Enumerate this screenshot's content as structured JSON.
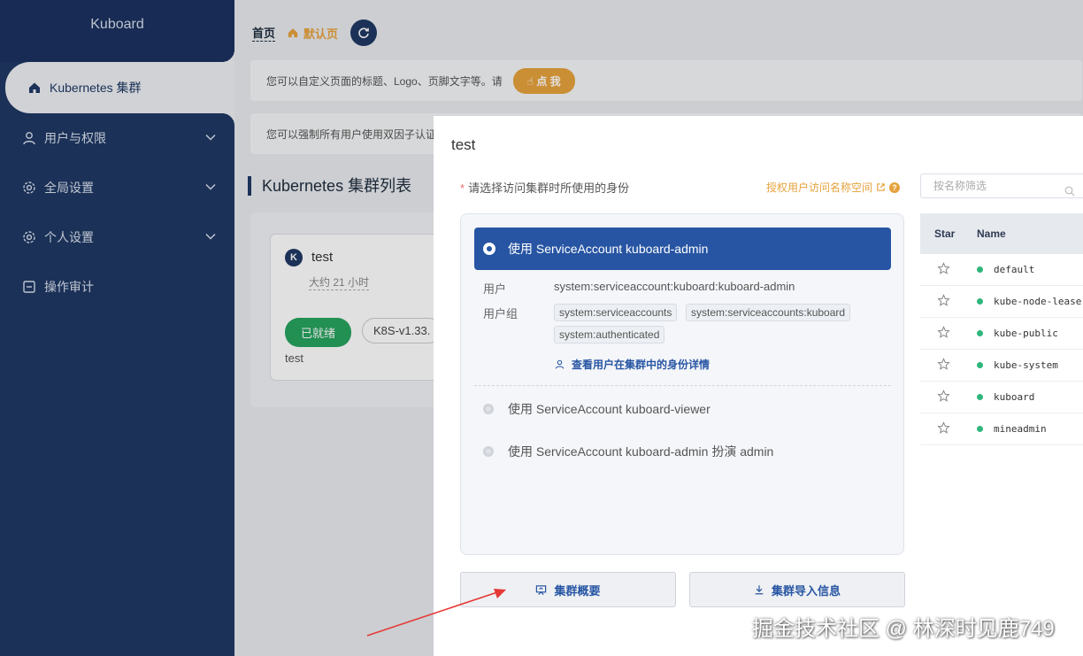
{
  "sidebar": {
    "logo": "Kuboard",
    "items": [
      {
        "label": "Kubernetes 集群",
        "icon": "home-icon"
      },
      {
        "label": "用户与权限",
        "icon": "user-icon"
      },
      {
        "label": "全局设置",
        "icon": "gear-icon"
      },
      {
        "label": "个人设置",
        "icon": "gear-icon"
      },
      {
        "label": "操作审计",
        "icon": "audit-icon"
      }
    ]
  },
  "header": {
    "home": "首页",
    "tab": "默认页"
  },
  "notices": {
    "customize": "您可以自定义页面的标题、Logo、页脚文字等。请",
    "click_me": "点 我",
    "two_factor": "您可以强制所有用户使用双因子认证"
  },
  "section_title": "Kubernetes 集群列表",
  "cluster_card": {
    "name": "test",
    "age": "大约 21 小时",
    "status": "已就绪",
    "version": "K8S-v1.33.",
    "description": "test"
  },
  "modal": {
    "title": "test",
    "identity_label": "请选择访问集群时所使用的身份",
    "grant_link": "授权用户访问名称空间",
    "options": [
      "使用 ServiceAccount kuboard-admin",
      "使用 ServiceAccount kuboard-viewer",
      "使用 ServiceAccount kuboard-admin 扮演 admin"
    ],
    "user_label": "用户",
    "user_value": "system:serviceaccount:kuboard:kuboard-admin",
    "group_label": "用户组",
    "groups": [
      "system:serviceaccounts",
      "system:serviceaccounts:kuboard",
      "system:authenticated"
    ],
    "detail_link": "查看用户在集群中的身份详情",
    "overview_button": "集群概要",
    "import_button": "集群导入信息",
    "filter_placeholder": "按名称筛选",
    "table_headers": {
      "star": "Star",
      "name": "Name"
    },
    "namespaces": [
      "default",
      "kube-node-lease",
      "kube-public",
      "kube-system",
      "kuboard",
      "mineadmin"
    ]
  },
  "watermark": "掘金技术社区 @ 林深时见鹿749",
  "colors": {
    "sidebar": "#1f3864",
    "primary": "#2755a3",
    "warning": "#e6a23c",
    "success": "#27a35f"
  }
}
